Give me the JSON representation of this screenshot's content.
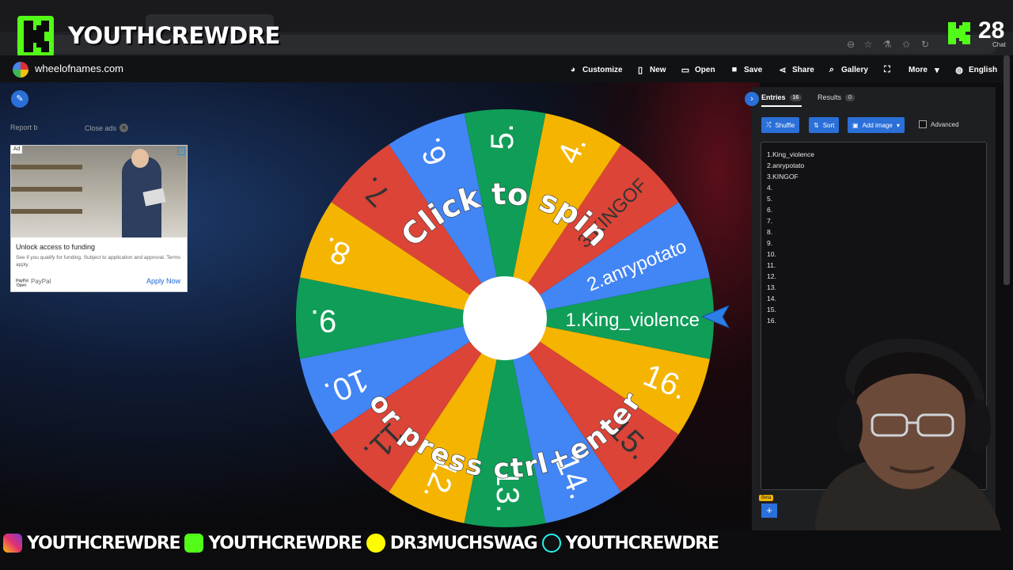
{
  "overlay": {
    "channel_name": "YOUTHCREWDRE",
    "viewer_count": "28",
    "chat_label": "Chat"
  },
  "site": {
    "domain": "wheelofnames.com",
    "nav": [
      {
        "label": "Customize",
        "icon": "palette-icon"
      },
      {
        "label": "New",
        "icon": "file-icon"
      },
      {
        "label": "Open",
        "icon": "folder-icon"
      },
      {
        "label": "Save",
        "icon": "save-icon"
      },
      {
        "label": "Share",
        "icon": "share-icon"
      },
      {
        "label": "Gallery",
        "icon": "search-icon"
      },
      {
        "label": "",
        "icon": "fullscreen-icon"
      },
      {
        "label": "More",
        "icon": "chevron-down-icon"
      },
      {
        "label": "English",
        "icon": "globe-icon"
      }
    ]
  },
  "left": {
    "report_label": "Report b",
    "close_ads_label": "Close ads"
  },
  "ad": {
    "badge": "Ad",
    "headline": "Unlock access to funding",
    "body": "See if you qualify for funding. Subject to application and approval. Terms apply.",
    "sponsor": "PayPal",
    "logo_text": "PayPal Open",
    "cta": "Apply Now"
  },
  "wheel": {
    "center_text_top": "Click to spin",
    "center_text_bottom": "or press ctrl+enter",
    "segments": [
      "1.King_violence",
      "2.anrypotato",
      "3.KINGOF",
      "4.",
      "5.",
      "6.",
      "7.",
      "8.",
      "9.",
      "10.",
      "11.",
      "12.",
      "13.",
      "14.",
      "15.",
      "16."
    ],
    "colors": [
      "#4285f4",
      "#db4437",
      "#f4b400",
      "#0f9d58"
    ]
  },
  "sidebar": {
    "tabs": [
      {
        "label": "Entries",
        "count": "16"
      },
      {
        "label": "Results",
        "count": "0"
      }
    ],
    "buttons": {
      "shuffle": "Shuffle",
      "sort": "Sort",
      "add_image": "Add image",
      "advanced": "Advanced"
    },
    "entries": [
      "1.King_violence",
      "2.anrypotato",
      "3.KINGOF",
      "4.",
      "5.",
      "6.",
      "7.",
      "8.",
      "9.",
      "10.",
      "11.",
      "12.",
      "13.",
      "14.",
      "15.",
      "16."
    ],
    "beta_label": "Beta"
  },
  "socials": [
    {
      "platform": "instagram-icon",
      "handle": "YOUTHCREWDRE"
    },
    {
      "platform": "kick-icon",
      "handle": "YOUTHCREWDRE"
    },
    {
      "platform": "snapchat-icon",
      "handle": "DR3MUCHSWAG"
    },
    {
      "platform": "tiktok-icon",
      "handle": "YOUTHCREWDRE"
    }
  ]
}
